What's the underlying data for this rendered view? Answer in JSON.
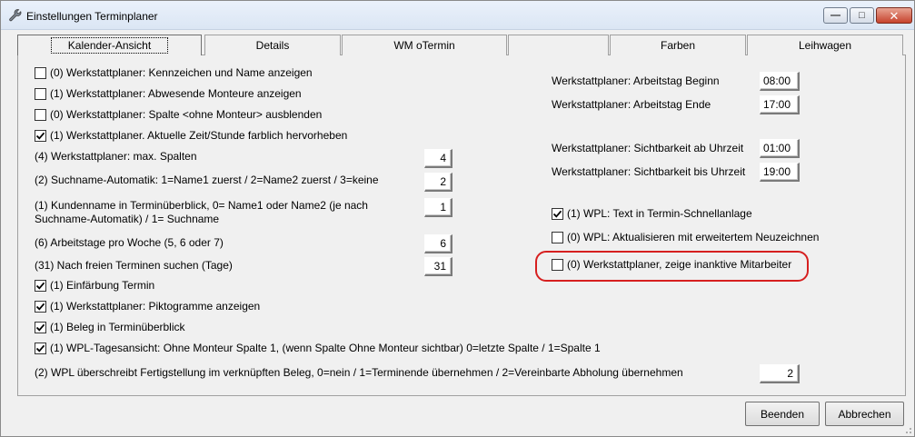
{
  "window": {
    "title": "Einstellungen Terminplaner"
  },
  "tabs": [
    "Kalender-Ansicht",
    "Details",
    "WM oTermin",
    "",
    "Farben",
    "Leihwagen"
  ],
  "left": {
    "cb0": {
      "label": "(0) Werkstattplaner: Kennzeichen und Name anzeigen",
      "checked": false
    },
    "cb1": {
      "label": "(1) Werkstattplaner: Abwesende Monteure anzeigen",
      "checked": false
    },
    "cb2": {
      "label": "(0) Werkstattplaner: Spalte <ohne Monteur> ausblenden",
      "checked": false
    },
    "cb3": {
      "label": "(1) Werkstattplaner. Aktuelle Zeit/Stunde farblich hervorheben",
      "checked": true
    },
    "f0": {
      "label": "(4) Werkstattplaner: max. Spalten",
      "value": "4"
    },
    "f1": {
      "label": "(2) Suchname-Automatik: 1=Name1 zuerst / 2=Name2 zuerst / 3=keine",
      "value": "2"
    },
    "f2": {
      "label_line1": "(1) Kundenname in Terminüberblick, 0= Name1 oder Name2 (je nach",
      "label_line2": "Suchname-Automatik) / 1= Suchname",
      "value": "1"
    },
    "f3": {
      "label": "(6) Arbeitstage pro Woche (5, 6 oder 7)",
      "value": "6"
    },
    "f4": {
      "label": "(31) Nach freien Terminen suchen (Tage)",
      "value": "31"
    },
    "cb4": {
      "label": "(1) Einfärbung Termin",
      "checked": true
    },
    "cb5": {
      "label": "(1) Werkstattplaner: Piktogramme anzeigen",
      "checked": true
    },
    "cb6": {
      "label": "(1) Beleg in Terminüberblick",
      "checked": true
    },
    "cb7": {
      "label": "(1) WPL-Tagesansicht: Ohne Monteur Spalte 1, (wenn Spalte Ohne Monteur sichtbar) 0=letzte Spalte / 1=Spalte 1",
      "checked": true
    },
    "f5": {
      "label": "(2) WPL überschreibt Fertigstellung im verknüpften Beleg, 0=nein / 1=Terminende übernehmen / 2=Vereinbarte Abholung übernehmen",
      "value": "2"
    }
  },
  "right": {
    "t0": {
      "label": "Werkstattplaner: Arbeitstag Beginn",
      "value": "08:00"
    },
    "t1": {
      "label": "Werkstattplaner: Arbeitstag Ende",
      "value": "17:00"
    },
    "t2": {
      "label": "Werkstattplaner: Sichtbarkeit ab Uhrzeit",
      "value": "01:00"
    },
    "t3": {
      "label": "Werkstattplaner: Sichtbarkeit bis Uhrzeit",
      "value": "19:00"
    },
    "cb0": {
      "label": "(1) WPL: Text in Termin-Schnellanlage",
      "checked": true
    },
    "cb1": {
      "label": "(0) WPL: Aktualisieren mit erweitertem Neuzeichnen",
      "checked": false
    },
    "cb2": {
      "label": "(0) Werkstattplaner, zeige inanktive Mitarbeiter",
      "checked": false
    }
  },
  "highlight_color": "#d61f1f",
  "buttons": {
    "quit": "Beenden",
    "cancel": "Abbrechen"
  }
}
